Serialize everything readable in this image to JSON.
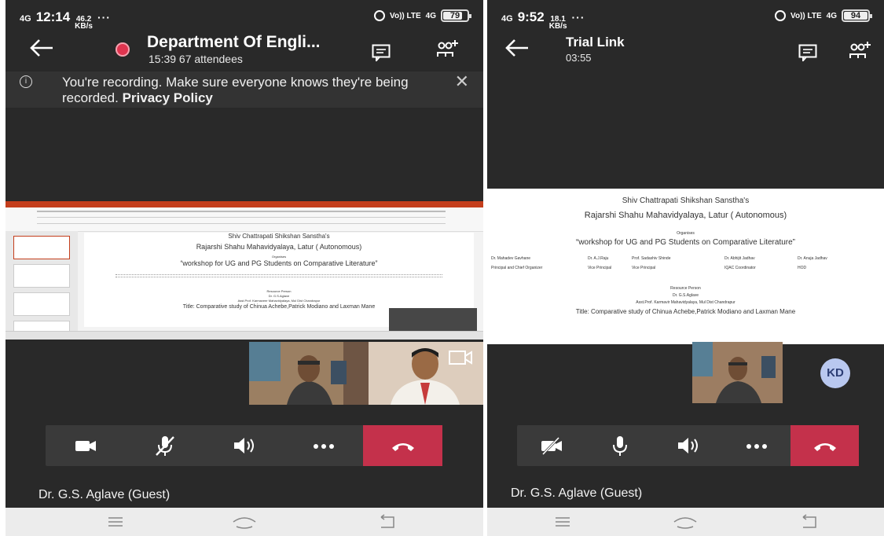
{
  "left": {
    "status": {
      "network": "4G",
      "time": "12:14",
      "speed_value": "46.2",
      "speed_unit": "KB/s",
      "dots": "···",
      "volte": "Vo)) LTE",
      "net": "4G",
      "battery": "79"
    },
    "meeting_title": "Department Of Engli...",
    "meeting_sub": "15:39  67 attendees",
    "banner": {
      "text": "You're recording. Make sure everyone knows they're being recorded.",
      "link": "Privacy Policy"
    },
    "participant_name": "Dr. G.S. Aglave (Guest)",
    "slide_lines": {
      "l1": "Shiv Chattrapati Shikshan Sanstha's",
      "l2": "Rajarshi Shahu Mahavidyalaya, Latur  ( Autonomous)",
      "l3": "Organises",
      "l4": "“workshop for UG and PG Students on Comparative Literature”",
      "l5": "Resource Person",
      "l6": "Dr. G.S.Aglave",
      "l7": "Asst.Prof. Karmaveer Mahavidyalaya, Mul Dist Chandrapur",
      "l8": "Title: Comparative study of Chinua Achebe,Patrick Modiano and Laxman Mane"
    }
  },
  "right": {
    "status": {
      "network": "4G",
      "time": "9:52",
      "speed_value": "18.1",
      "speed_unit": "KB/s",
      "dots": "···",
      "volte": "Vo)) LTE",
      "net": "4G",
      "battery": "94"
    },
    "meeting_title": "Trial Link",
    "meeting_sub": "03:55",
    "avatar_initials": "KD",
    "participant_name": "Dr. G.S. Aglave (Guest)",
    "slide_lines": {
      "l1": "Shiv Chattrapati Shikshan Sanstha's",
      "l2": "Rajarshi Shahu Mahavidyalaya, Latur  ( Autonomous)",
      "l3": "Organises",
      "l4": "“workshop for UG and PG Students on Comparative Literature”",
      "p1n": "Dr. Mahadev Gavhane",
      "p1r": "Principal and Chief Organizer",
      "p2n": "Dr. A.J.Raju",
      "p2r": "Vice Principal",
      "p3n": "Prof. Sadashiv Shinde",
      "p3r": "Vice Principal",
      "p4n": "Dr. Abhijit Jadhav",
      "p4r": "IQAC Coordinator",
      "p5n": "Dr. Anuja Jadhav",
      "p5r": "HOD",
      "l5": "Resource Person",
      "l6": "Dr. G.S.Aglave",
      "l7": "Asst.Prof. Karmavir Mahavidyalaya, Mul Dist Chandrapur",
      "l8": "Title: Comparative study of Chinua Achebe,Patrick Modiano and Laxman Mane"
    }
  },
  "colors": {
    "end_call": "#c4314b",
    "record": "#e0344f",
    "background": "#292929"
  }
}
